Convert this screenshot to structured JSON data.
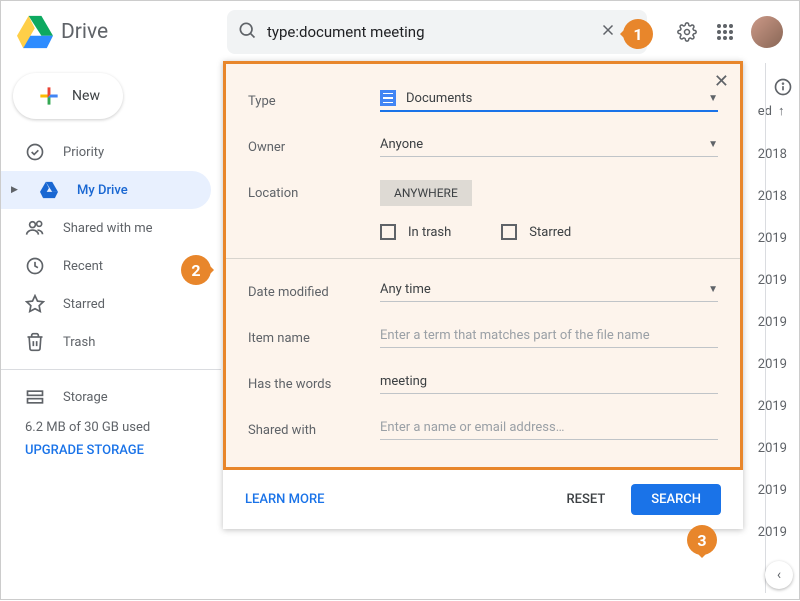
{
  "header": {
    "app_name": "Drive",
    "search_value": "type:document meeting"
  },
  "sidebar": {
    "new_label": "New",
    "items": [
      {
        "label": "Priority",
        "icon": "priority"
      },
      {
        "label": "My Drive",
        "icon": "drive",
        "active": true
      },
      {
        "label": "Shared with me",
        "icon": "shared"
      },
      {
        "label": "Recent",
        "icon": "recent"
      },
      {
        "label": "Starred",
        "icon": "star"
      },
      {
        "label": "Trash",
        "icon": "trash"
      }
    ],
    "storage_label": "Storage",
    "storage_used": "6.2 MB of 30 GB used",
    "upgrade_label": "UPGRADE STORAGE"
  },
  "panel": {
    "fields": {
      "type_label": "Type",
      "type_value": "Documents",
      "owner_label": "Owner",
      "owner_value": "Anyone",
      "location_label": "Location",
      "location_value": "ANYWHERE",
      "in_trash": "In trash",
      "starred": "Starred",
      "date_label": "Date modified",
      "date_value": "Any time",
      "item_label": "Item name",
      "item_placeholder": "Enter a term that matches part of the file name",
      "words_label": "Has the words",
      "words_value": "meeting",
      "shared_label": "Shared with",
      "shared_placeholder": "Enter a name or email address…"
    },
    "learn_more": "LEARN MORE",
    "reset": "RESET",
    "search": "SEARCH"
  },
  "bg": {
    "col_header": "ed",
    "dates": [
      "2018",
      "2018",
      "2019",
      "2019",
      "2019",
      "2019",
      "2019",
      "2019",
      "2019",
      "2019"
    ]
  },
  "callouts": {
    "c1": "1",
    "c2": "2",
    "c3": "3"
  }
}
